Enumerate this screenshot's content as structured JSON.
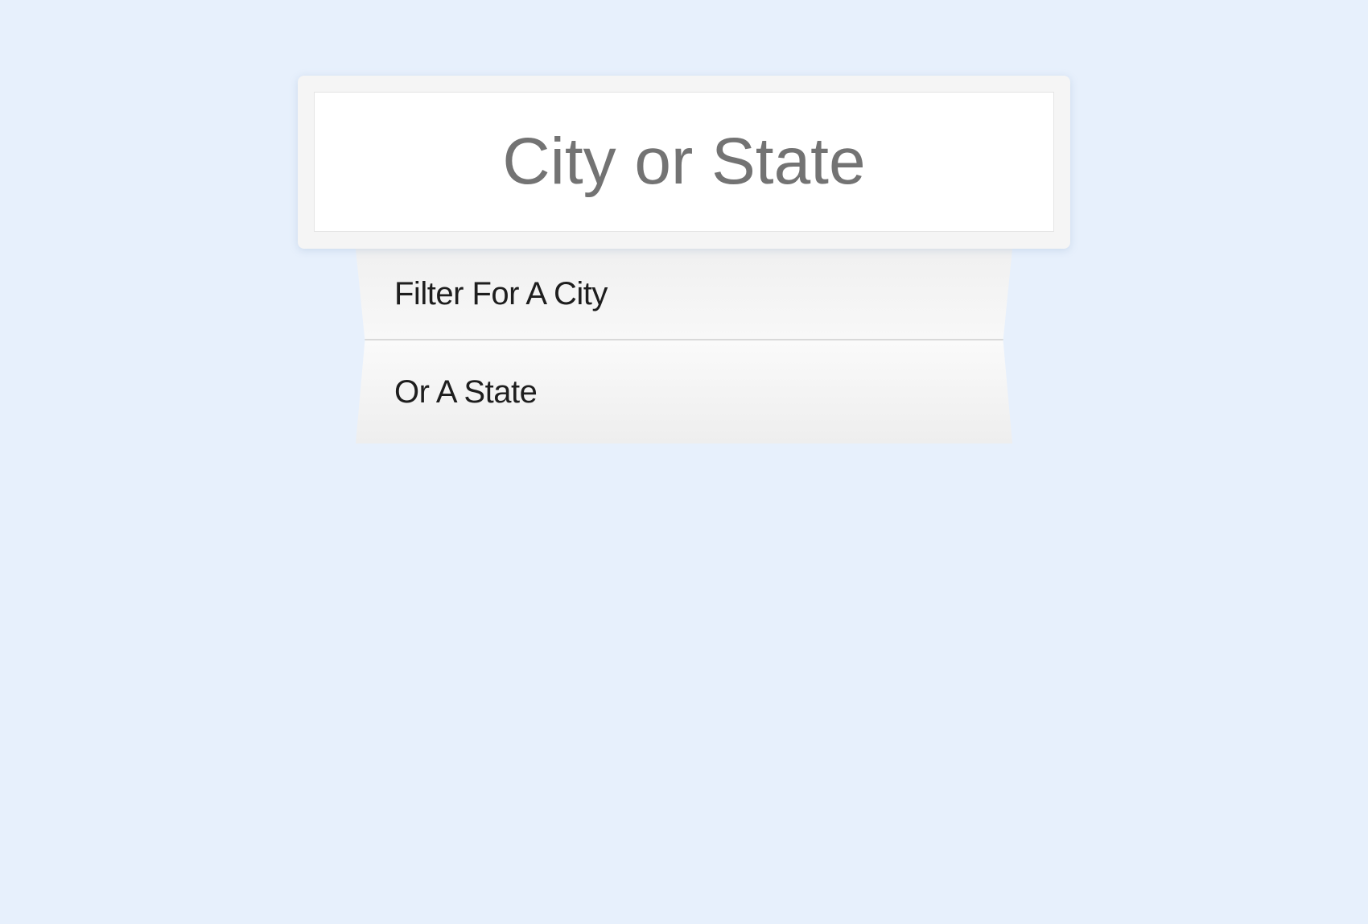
{
  "search": {
    "placeholder": "City or State",
    "value": ""
  },
  "suggestions": {
    "items": [
      {
        "label": "Filter For A City"
      },
      {
        "label": "Or A State"
      }
    ]
  }
}
